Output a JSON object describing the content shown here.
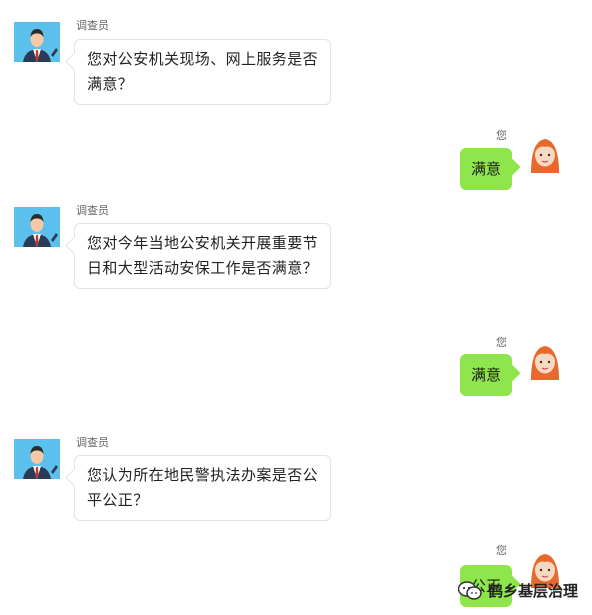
{
  "chat": {
    "surveyor_name": "调查员",
    "user_name": "您",
    "q1": "您对公安机关现场、网上服务是否满意？",
    "a1": "满意",
    "q2": "您对今年当地公安机关开展重要节日和大型活动安保工作是否满意？",
    "a2": "满意",
    "q3": "您认为所在地民警执法办案是否公平公正？",
    "a3": "公正"
  },
  "watermark": {
    "text": "鹤乡基层治理",
    "icon": "wechat-icon"
  },
  "colors": {
    "user_bubble": "#8ee64c",
    "surveyor_bubble": "#ffffff",
    "border": "#e3e3e3"
  }
}
